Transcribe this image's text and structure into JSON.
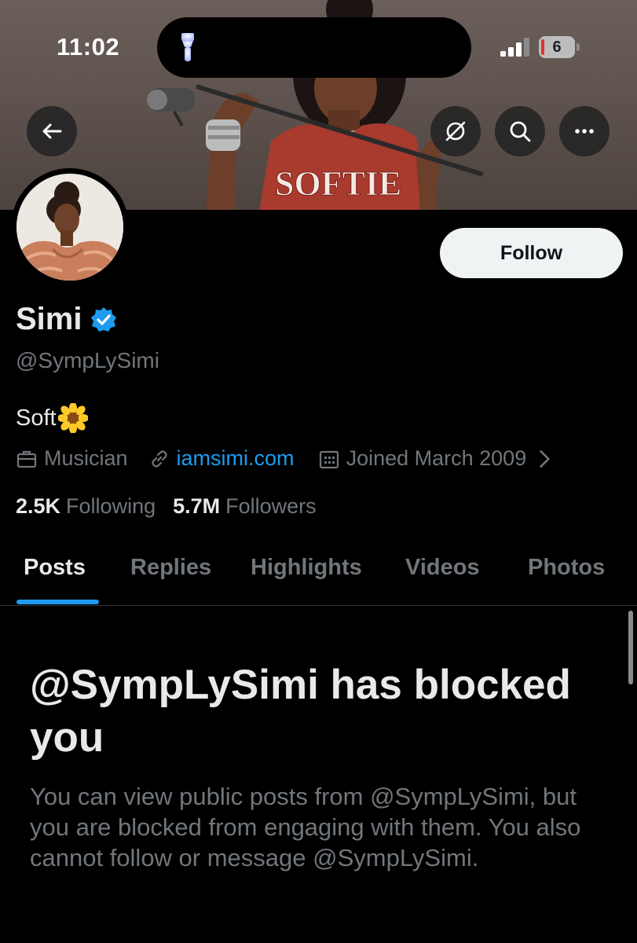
{
  "status_bar": {
    "time": "11:02",
    "battery": "6"
  },
  "header_actions": {
    "back_icon": "arrow-left-icon",
    "hide_icon": "eye-slash-icon",
    "search_icon": "search-icon",
    "more_icon": "more-icon"
  },
  "banner": {
    "shirt_text": "SOFTIE"
  },
  "profile": {
    "name": "Simi",
    "handle": "@SympLySimi",
    "bio": "Soft",
    "bio_emoji": "sunflower",
    "follow_label": "Follow",
    "verified_color": "#1d9bf0",
    "category": "Musician",
    "website": "iamsimi.com",
    "joined": "Joined March 2009",
    "following_count": "2.5K",
    "following_label": "Following",
    "followers_count": "5.7M",
    "followers_label": "Followers"
  },
  "tabs": [
    {
      "label": "Posts",
      "active": true
    },
    {
      "label": "Replies",
      "active": false
    },
    {
      "label": "Highlights",
      "active": false
    },
    {
      "label": "Videos",
      "active": false
    },
    {
      "label": "Photos",
      "active": false
    }
  ],
  "blocked": {
    "title": "@SympLySimi has blocked you",
    "body": "You can view public posts from @SympLySimi, but you are blocked from engaging with them. You also cannot follow or message @SympLySimi."
  },
  "colors": {
    "accent": "#1d9bf0",
    "background": "#000000",
    "secondary_text": "#71767b"
  }
}
